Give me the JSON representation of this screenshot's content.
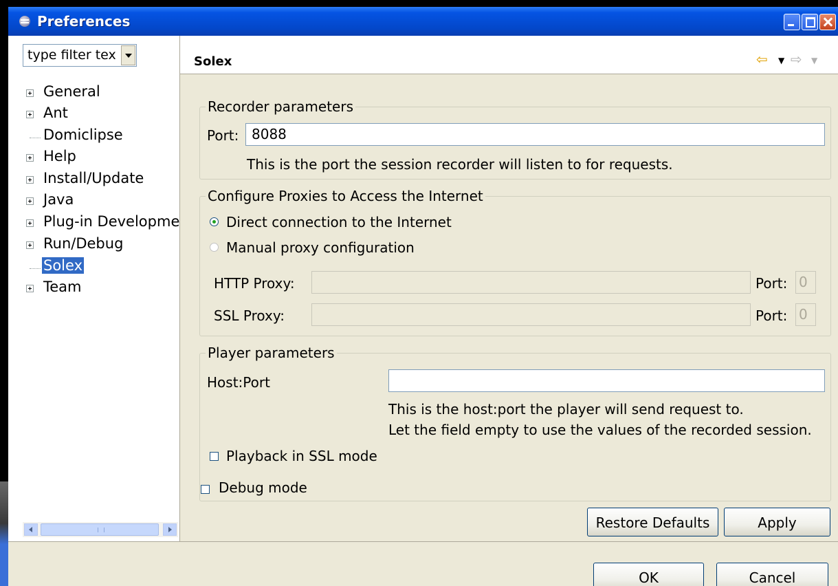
{
  "window": {
    "title": "Preferences"
  },
  "filter": {
    "text": "type filter tex"
  },
  "tree": {
    "items": [
      {
        "label": "General",
        "expandable": true
      },
      {
        "label": "Ant",
        "expandable": true
      },
      {
        "label": "Domiclipse",
        "expandable": false
      },
      {
        "label": "Help",
        "expandable": true
      },
      {
        "label": "Install/Update",
        "expandable": true
      },
      {
        "label": "Java",
        "expandable": true
      },
      {
        "label": "Plug-in Developmer",
        "expandable": true
      },
      {
        "label": "Run/Debug",
        "expandable": true
      },
      {
        "label": "Solex",
        "expandable": false,
        "selected": true
      },
      {
        "label": "Team",
        "expandable": true
      }
    ]
  },
  "page": {
    "title": "Solex"
  },
  "recorder": {
    "legend": "Recorder parameters",
    "port_label": "Port:",
    "port_value": "8088",
    "hint": "This is the port the session recorder will listen to for requests."
  },
  "proxies": {
    "legend": "Configure Proxies to Access the Internet",
    "direct_label": "Direct connection to the Internet",
    "manual_label": "Manual proxy configuration",
    "selected": "direct",
    "http_label": "HTTP Proxy:",
    "http_value": "",
    "http_port_label": "Port:",
    "http_port_value": "0",
    "ssl_label": "SSL Proxy:",
    "ssl_value": "",
    "ssl_port_label": "Port:",
    "ssl_port_value": "0"
  },
  "player": {
    "legend": "Player parameters",
    "hostport_label": "Host:Port",
    "hostport_value": "",
    "hint_line1": "This is the host:port the player will send request to.",
    "hint_line2": "Let the field empty to use the values of the recorded session.",
    "ssl_mode_label": "Playback in SSL mode",
    "ssl_mode_checked": false
  },
  "debug": {
    "label": "Debug mode",
    "checked": false
  },
  "buttons": {
    "restore_defaults": "Restore Defaults",
    "apply": "Apply",
    "ok": "OK",
    "cancel": "Cancel"
  },
  "colors": {
    "titlebar": "#0554e3",
    "dialog_bg": "#ece9d8",
    "selection": "#316ac5"
  }
}
